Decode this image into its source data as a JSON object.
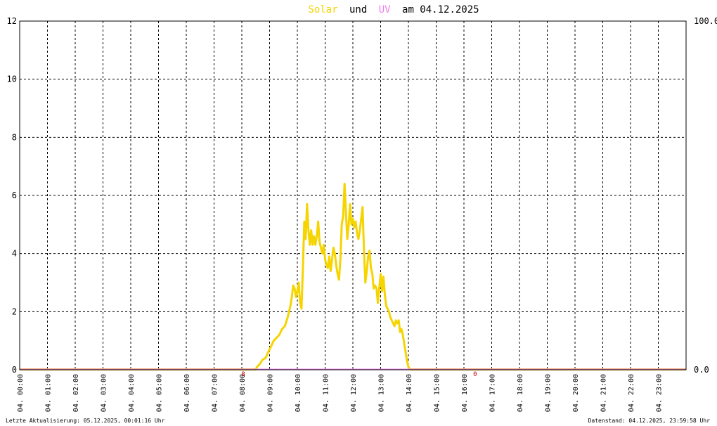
{
  "chart_data": {
    "type": "line",
    "title_parts": {
      "solar": "Solar",
      "und": "und",
      "uv": "UV",
      "rest": "am 04.12.2025"
    },
    "colors": {
      "solar": "#f5d400",
      "uv": "#ee82ee",
      "baseline": "#f09070",
      "title_text": "#000000",
      "marker": "#cc0000"
    },
    "y_left": {
      "min": 0,
      "max": 12,
      "ticks": [
        "0",
        "2",
        "4",
        "6",
        "8",
        "10",
        "12"
      ]
    },
    "y_right": {
      "min": 0,
      "max": 100,
      "ticks": [
        "0.0",
        "100.0"
      ]
    },
    "x_range_hours": [
      0,
      24
    ],
    "x_tick_labels": [
      "04. 00:00",
      "04. 01:00",
      "04. 02:00",
      "04. 03:00",
      "04. 04:00",
      "04. 05:00",
      "04. 06:00",
      "04. 07:00",
      "04. 08:00",
      "04. 09:00",
      "04. 10:00",
      "04. 11:00",
      "04. 12:00",
      "04. 13:00",
      "04. 14:00",
      "04. 15:00",
      "04. 16:00",
      "04. 17:00",
      "04. 18:00",
      "04. 19:00",
      "04. 20:00",
      "04. 21:00",
      "04. 22:00",
      "04. 23:00"
    ],
    "grid": true,
    "markers": [
      {
        "hour": 8.05,
        "label": "8"
      },
      {
        "hour": 16.4,
        "label": "0"
      }
    ],
    "series": [
      {
        "key": "solar",
        "x": [
          0,
          8.5,
          8.55,
          8.65,
          8.75,
          8.85,
          8.95,
          9.05,
          9.15,
          9.25,
          9.35,
          9.45,
          9.55,
          9.65,
          9.75,
          9.8,
          9.85,
          9.9,
          9.95,
          10.0,
          10.05,
          10.1,
          10.15,
          10.2,
          10.25,
          10.3,
          10.35,
          10.4,
          10.45,
          10.5,
          10.55,
          10.6,
          10.65,
          10.7,
          10.75,
          10.8,
          10.85,
          10.9,
          10.95,
          11.0,
          11.05,
          11.1,
          11.15,
          11.2,
          11.25,
          11.3,
          11.35,
          11.4,
          11.45,
          11.5,
          11.55,
          11.6,
          11.65,
          11.7,
          11.75,
          11.8,
          11.85,
          11.9,
          11.95,
          12.0,
          12.05,
          12.1,
          12.15,
          12.2,
          12.25,
          12.3,
          12.35,
          12.4,
          12.45,
          12.5,
          12.55,
          12.6,
          12.65,
          12.7,
          12.75,
          12.8,
          12.85,
          12.9,
          12.95,
          13.0,
          13.05,
          13.1,
          13.15,
          13.2,
          13.25,
          13.3,
          13.35,
          13.4,
          13.45,
          13.5,
          13.55,
          13.6,
          13.65,
          13.7,
          13.75,
          13.8,
          13.85,
          13.9,
          13.95,
          14.0,
          14.05,
          14.1,
          14.15,
          14.2,
          14.3,
          14.4,
          14.5,
          14.6,
          14.7,
          14.8,
          14.9,
          15.0,
          15.05,
          15.1,
          15.15,
          15.2,
          15.3,
          15.4,
          15.5,
          15.6,
          15.7,
          15.8,
          15.9,
          16.0,
          16.1,
          16.2,
          24
        ],
        "y": [
          0,
          0,
          0.1,
          0.2,
          0.35,
          0.4,
          0.6,
          0.8,
          1.0,
          1.1,
          1.2,
          1.4,
          1.5,
          1.8,
          2.2,
          2.5,
          2.9,
          2.8,
          2.5,
          2.7,
          3.0,
          2.3,
          2.1,
          3.5,
          5.1,
          4.5,
          5.7,
          4.8,
          4.3,
          4.8,
          4.3,
          4.6,
          4.3,
          4.6,
          5.1,
          4.4,
          4.2,
          4.0,
          4.3,
          3.8,
          3.6,
          3.5,
          3.9,
          3.4,
          3.8,
          4.2,
          4.0,
          3.6,
          3.3,
          3.1,
          3.8,
          5.0,
          5.3,
          6.4,
          5.4,
          4.5,
          5.0,
          5.7,
          5.0,
          5.2,
          4.9,
          5.1,
          4.7,
          4.5,
          4.8,
          5.2,
          5.6,
          4.1,
          3.0,
          3.4,
          3.9,
          4.1,
          3.5,
          3.3,
          2.8,
          2.9,
          2.8,
          2.3,
          2.8,
          3.3,
          2.7,
          3.2,
          2.6,
          2.2,
          2.1,
          2.0,
          1.8,
          1.7,
          1.6,
          1.5,
          1.7,
          1.6,
          1.7,
          1.3,
          1.4,
          1.2,
          0.9,
          0.6,
          0.3,
          0.1,
          0.02,
          0,
          0,
          0,
          0,
          0,
          0,
          0,
          0,
          0,
          0,
          0,
          0,
          0,
          0,
          0,
          0,
          0,
          0,
          0,
          0,
          0,
          0,
          0,
          0,
          0,
          0
        ],
        "axis": "left"
      },
      {
        "key": "uv",
        "x": [
          0,
          8.45,
          8.5,
          16.2,
          16.25,
          24
        ],
        "y": [
          0,
          0,
          0.0,
          0.0,
          0,
          0
        ],
        "axis": "right"
      }
    ]
  },
  "footer": {
    "left": "Letzte Aktualisierung: 05.12.2025, 00:01:16 Uhr",
    "right": "Datenstand: 04.12.2025, 23:59:58 Uhr"
  }
}
